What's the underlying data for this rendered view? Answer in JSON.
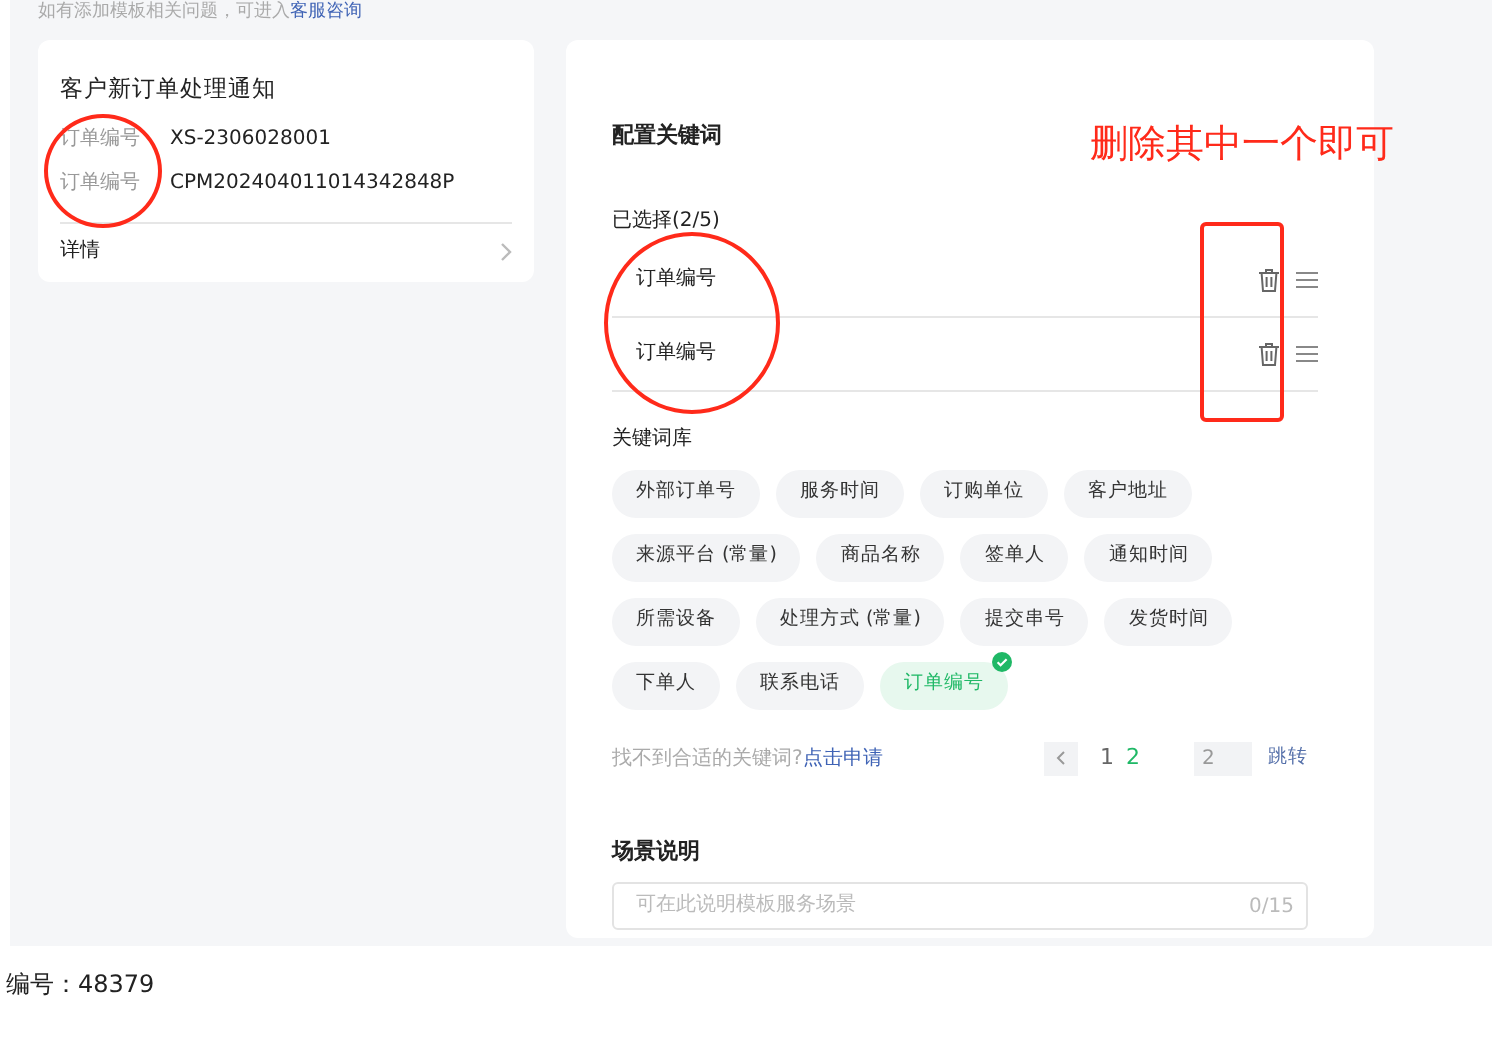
{
  "notice": {
    "text": "如有添加模板相关问题，可进入",
    "link": "客服咨询"
  },
  "preview_card": {
    "title": "客户新订单处理通知",
    "fields": [
      {
        "label": "订单编号",
        "value": "XS-2306028001"
      },
      {
        "label": "订单编号",
        "value": "CPM202404011014342848P"
      }
    ],
    "details_link": "详情"
  },
  "config": {
    "title": "配置关键词",
    "selected_label": "已选择(2/5)",
    "selected_items": [
      {
        "label": "订单编号"
      },
      {
        "label": "订单编号"
      }
    ],
    "library_label": "关键词库",
    "keywords": [
      {
        "label": "外部订单号",
        "selected": false
      },
      {
        "label": "服务时间",
        "selected": false
      },
      {
        "label": "订购单位",
        "selected": false
      },
      {
        "label": "客户地址",
        "selected": false
      },
      {
        "label": "来源平台 (常量)",
        "selected": false
      },
      {
        "label": "商品名称",
        "selected": false
      },
      {
        "label": "签单人",
        "selected": false
      },
      {
        "label": "通知时间",
        "selected": false
      },
      {
        "label": "所需设备",
        "selected": false
      },
      {
        "label": "处理方式 (常量)",
        "selected": false
      },
      {
        "label": "提交串号",
        "selected": false
      },
      {
        "label": "发货时间",
        "selected": false
      },
      {
        "label": "下单人",
        "selected": false
      },
      {
        "label": "联系电话",
        "selected": false
      },
      {
        "label": "订单编号",
        "selected": true
      }
    ],
    "help_text": "找不到合适的关键词?",
    "help_link": "点击申请",
    "pagination": {
      "pages": [
        {
          "label": "1",
          "selected": false
        },
        {
          "label": "2",
          "selected": true
        }
      ],
      "jump_value": "2",
      "jump_button": "跳转"
    }
  },
  "scene": {
    "title": "场景说明",
    "placeholder": "可在此说明模板服务场景",
    "counter": "0/15"
  },
  "annotation": {
    "text": "删除其中一个即可"
  },
  "footer": {
    "text": "编号：48379"
  }
}
